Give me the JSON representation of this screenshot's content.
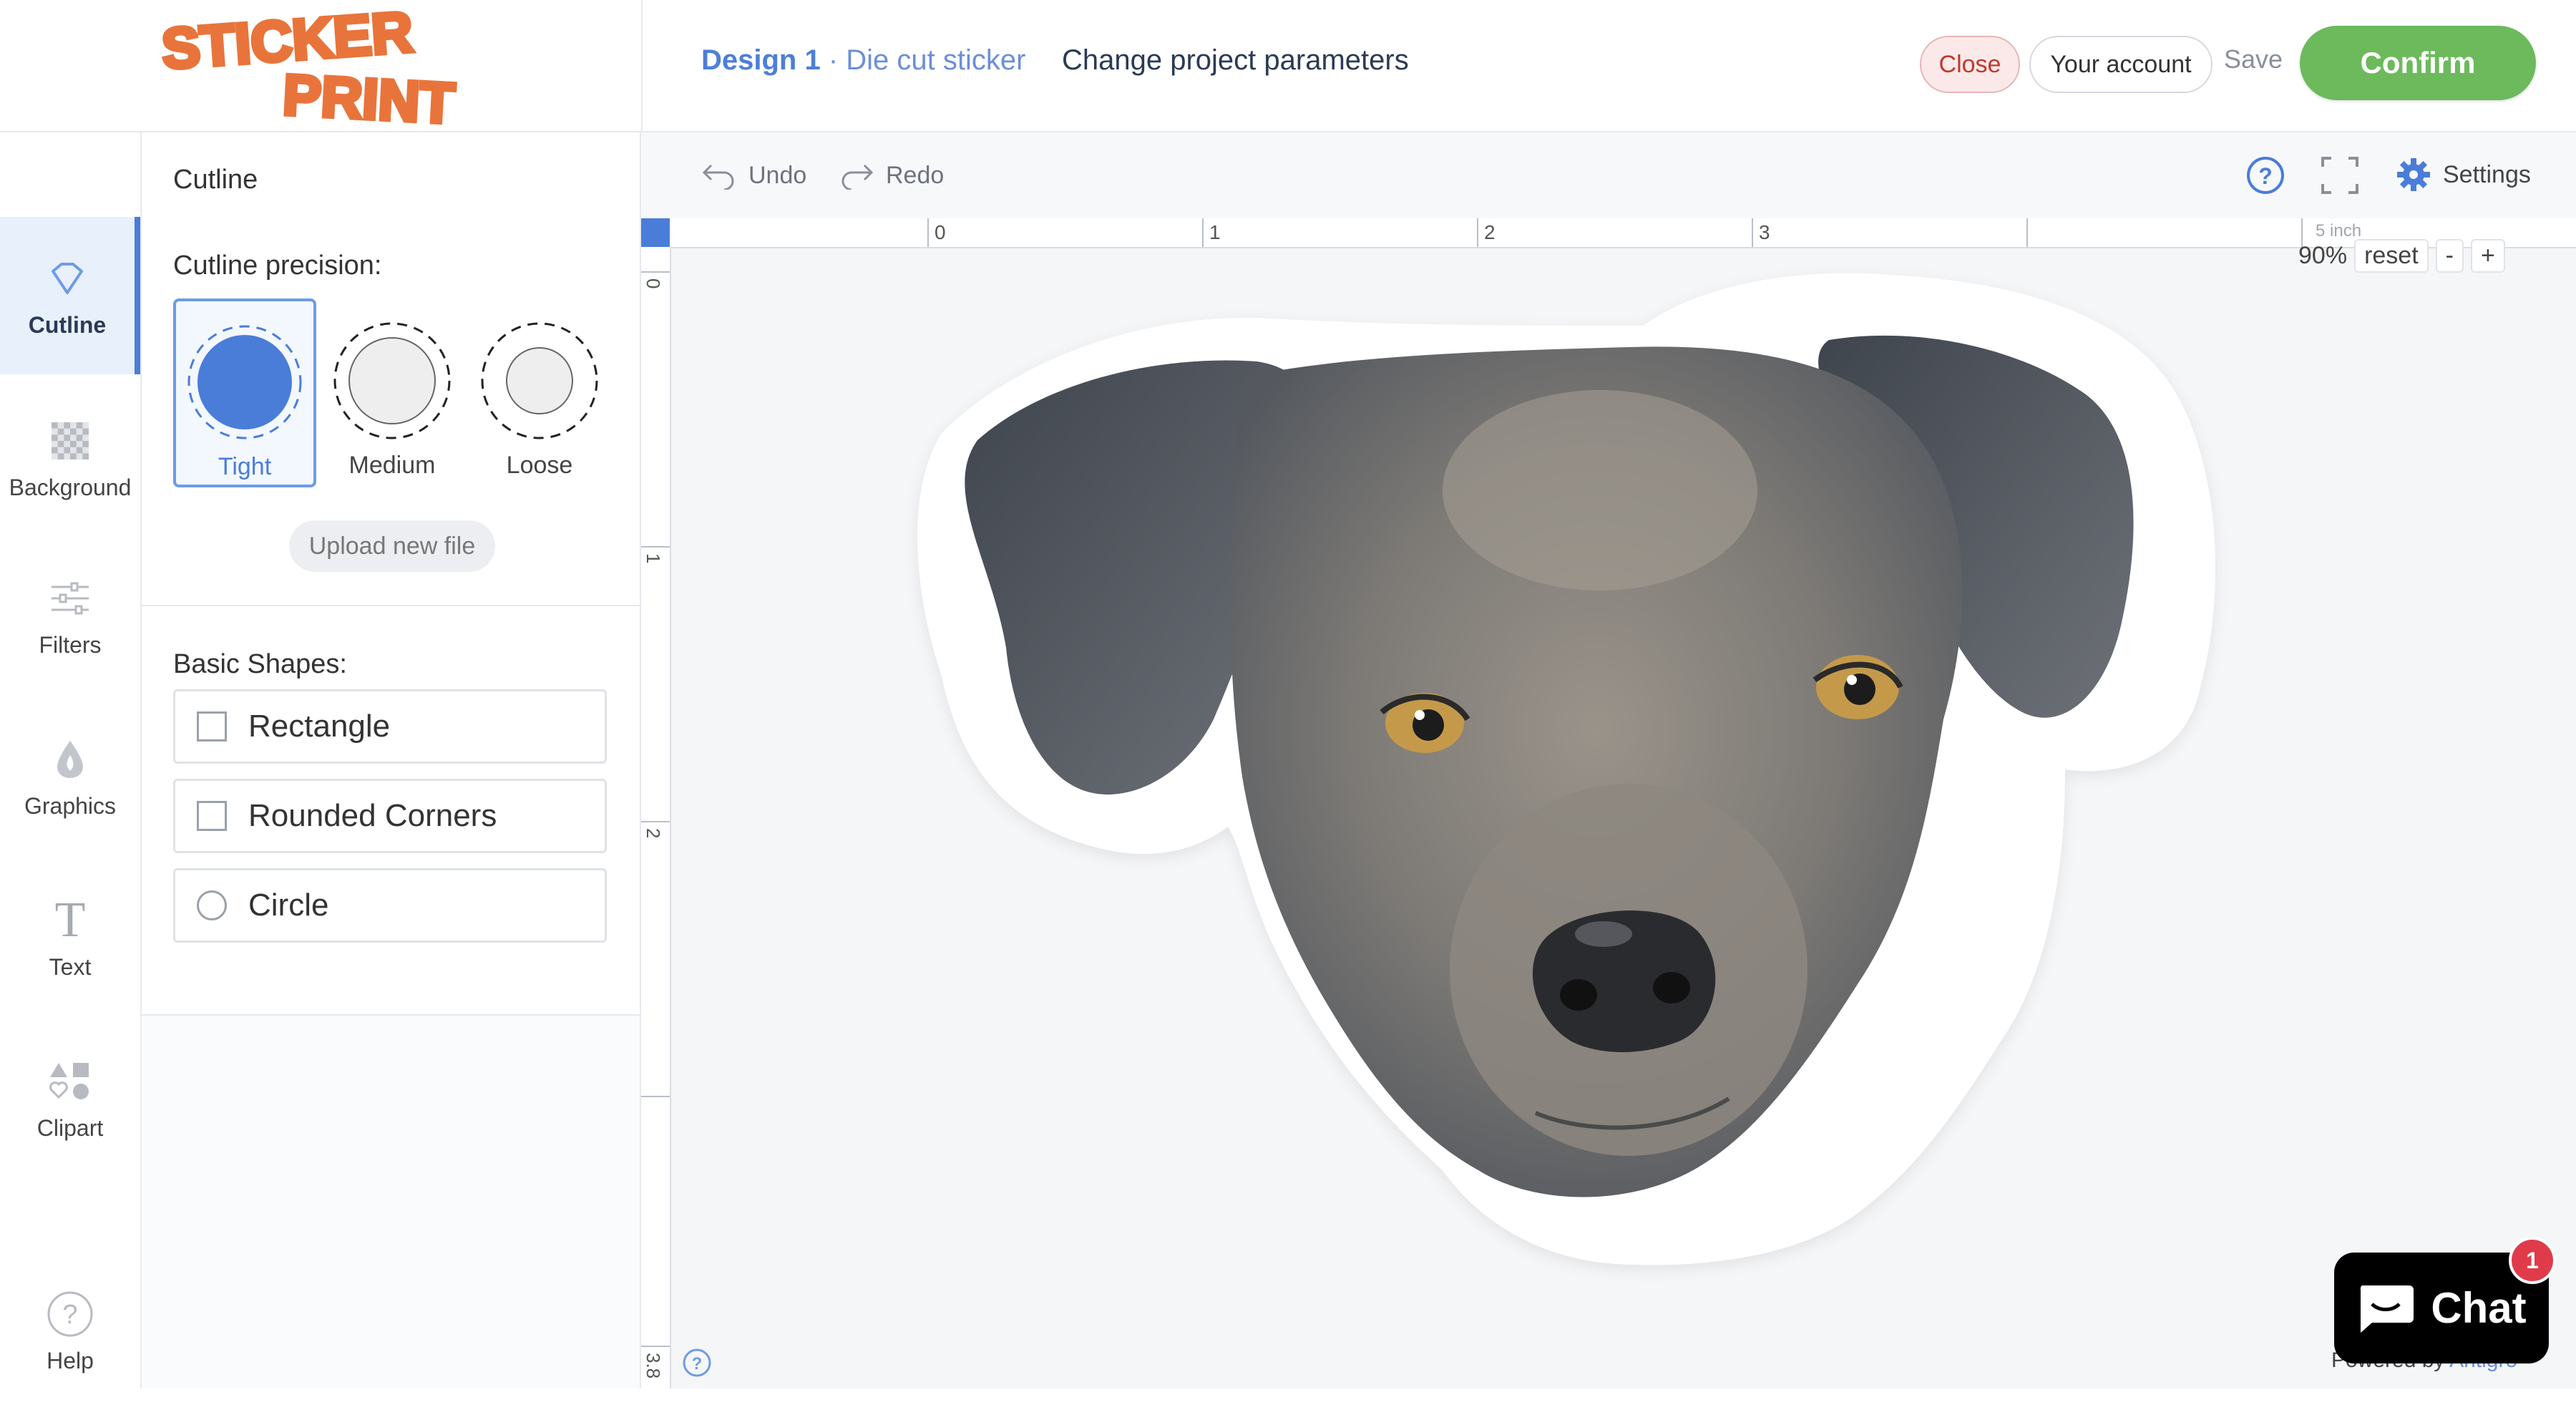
{
  "header": {
    "logo_line1": "STICKER",
    "logo_line2": "PRINT",
    "design_name": "Design 1",
    "design_sep": " · ",
    "product": "Die cut sticker",
    "change_params": "Change project parameters",
    "close_label": "Close",
    "account_label": "Your account",
    "save_label": "Save",
    "confirm_label": "Confirm"
  },
  "leftnav": {
    "items": [
      {
        "label": "Cutline",
        "icon": "cutline-icon"
      },
      {
        "label": "Background",
        "icon": "checker-icon"
      },
      {
        "label": "Filters",
        "icon": "sliders-icon"
      },
      {
        "label": "Graphics",
        "icon": "drop-icon"
      },
      {
        "label": "Text",
        "icon": "text-icon"
      },
      {
        "label": "Clipart",
        "icon": "shapes-icon"
      }
    ],
    "help_label": "Help"
  },
  "panel": {
    "title": "Cutline",
    "precision_label": "Cutline precision:",
    "options": [
      "Tight",
      "Medium",
      "Loose"
    ],
    "selected": "Tight",
    "upload_label": "Upload new file",
    "shapes_label": "Basic Shapes:",
    "shapes": [
      "Rectangle",
      "Rounded Corners",
      "Circle"
    ]
  },
  "toolbar": {
    "undo": "Undo",
    "redo": "Redo",
    "settings": "Settings"
  },
  "ruler": {
    "top_labels": [
      "0",
      "1",
      "2",
      "3"
    ],
    "unit_label": "5 inch",
    "left_labels": [
      "0",
      "1",
      "2",
      "3.8"
    ]
  },
  "zoom": {
    "level": "90%",
    "reset": "reset",
    "minus": "-",
    "plus": "+"
  },
  "chat": {
    "label": "Chat",
    "badge": "1",
    "powered": "Powered by ",
    "powered_brand": "Antigro"
  },
  "colors": {
    "accent": "#4a7dd8",
    "confirm": "#6cba5c",
    "close": "#c0392b",
    "logo": "#e8743b"
  }
}
